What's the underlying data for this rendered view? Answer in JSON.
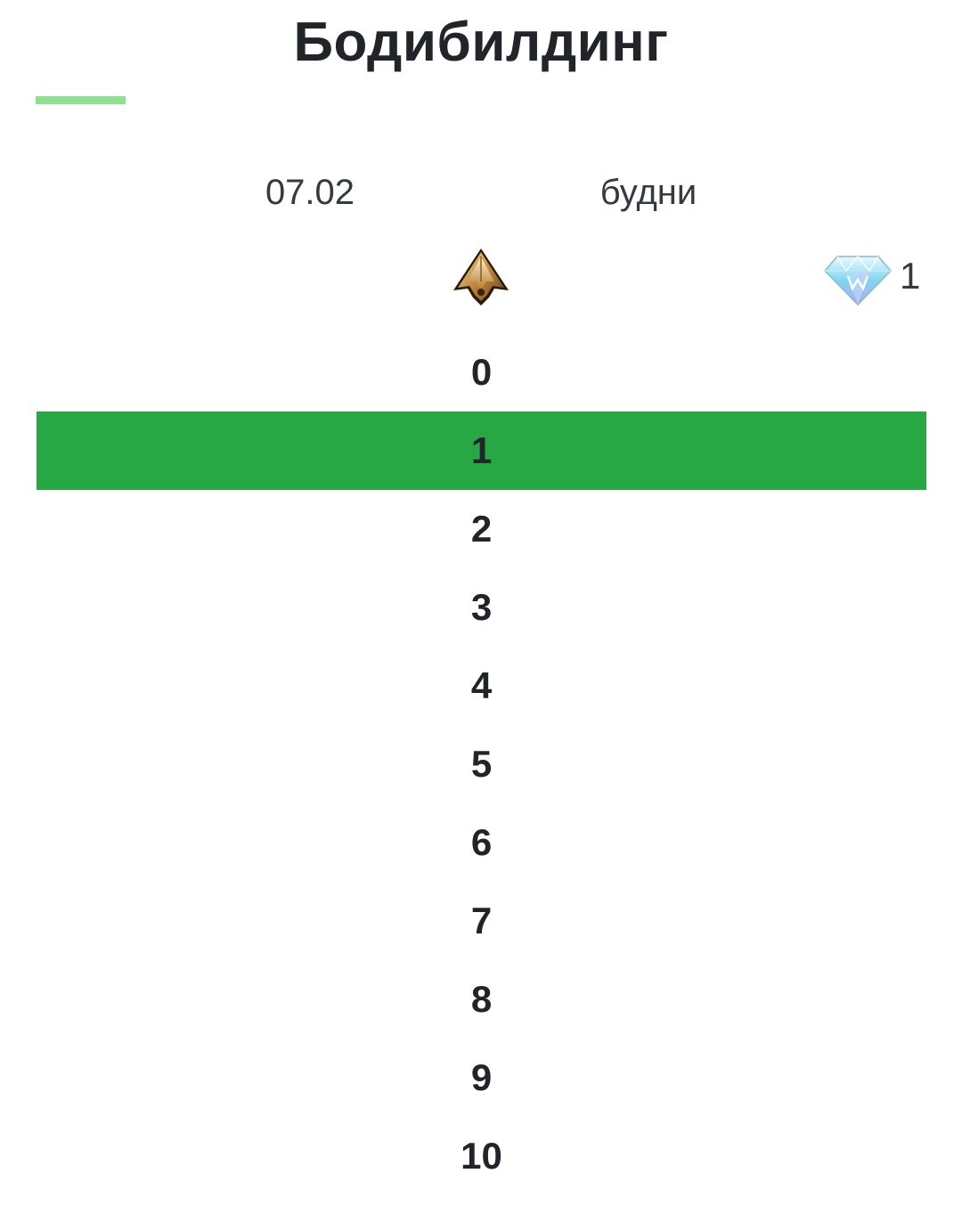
{
  "header": {
    "title": "Бодибилдинг"
  },
  "meta": {
    "date": "07.02",
    "schedule": "будни"
  },
  "rewards": {
    "rank_icon": "bronze-rank-icon",
    "gem_icon": "diamond-icon",
    "gem_count": "1"
  },
  "levels": [
    "0",
    "1",
    "2",
    "3",
    "4",
    "5",
    "6",
    "7",
    "8",
    "9",
    "10"
  ],
  "selected_level": "1",
  "colors": {
    "accent": "#28a745",
    "underline": "#8fe08f",
    "text": "#212529"
  }
}
